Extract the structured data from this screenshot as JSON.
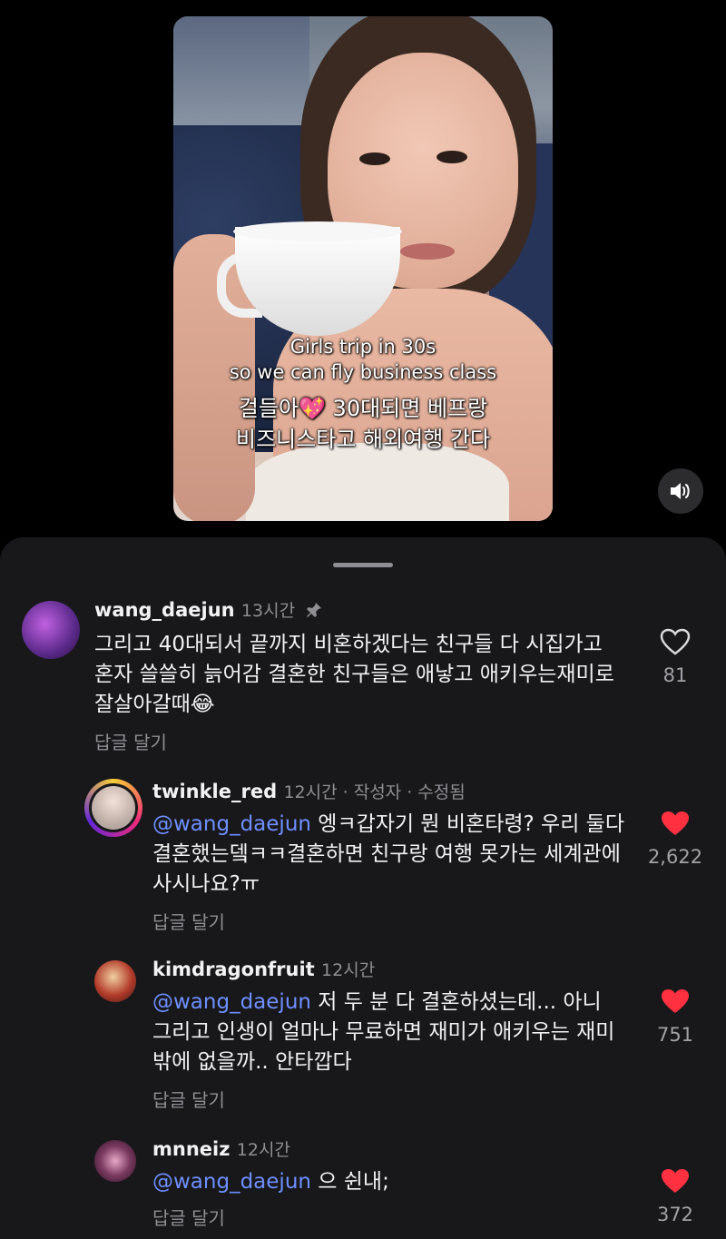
{
  "video": {
    "caption_line1": "Girls trip in 30s",
    "caption_line2": "so we can fly business class",
    "caption_line3": "걸들아💖 30대되면 베프랑",
    "caption_line4": "비즈니스타고 해외여행 간다",
    "sound_icon": "speaker-icon"
  },
  "comments": [
    {
      "username": "wang_daejun",
      "time": "13시간",
      "pinned_icon": "pin-icon",
      "text": "그리고 40대되서 끝까지 비혼하겠다는 친구들 다 시집가고 혼자 쓸쓸히 늙어감 결혼한 친구들은 애낳고 애키우는재미로 잘살아갈때😂",
      "reply_label": "답글 달기",
      "likes": "81",
      "liked": false
    },
    {
      "username": "twinkle_red",
      "time": "12시간 · 작성자 · 수정됨",
      "mention": "@wang_daejun",
      "text": " 엥ㅋ갑자기 뭔 비혼타령? 우리 둘다 결혼했는뎈ㅋㅋ결혼하면 친구랑 여행 못가는 세계관에 사시나요?ㅠ",
      "reply_label": "답글 달기",
      "likes": "2,622",
      "liked": true
    },
    {
      "username": "kimdragonfruit",
      "time": "12시간",
      "mention": "@wang_daejun",
      "text": " 저 두 분 다 결혼하셨는데... 아니 그리고 인생이 얼마나 무료하면 재미가 애키우는 재미밖에 없을까.. 안타깝다",
      "reply_label": "답글 달기",
      "likes": "751",
      "liked": true
    },
    {
      "username": "mnneiz",
      "time": "12시간",
      "mention": "@wang_daejun",
      "text": " 으 쉰내;",
      "reply_label": "답글 달기",
      "likes": "372",
      "liked": true
    }
  ],
  "colors": {
    "sheet_bg": "#18181b",
    "mention": "#6e8fff",
    "heart_liked": "#ff3040",
    "muted": "#8e8e93"
  }
}
